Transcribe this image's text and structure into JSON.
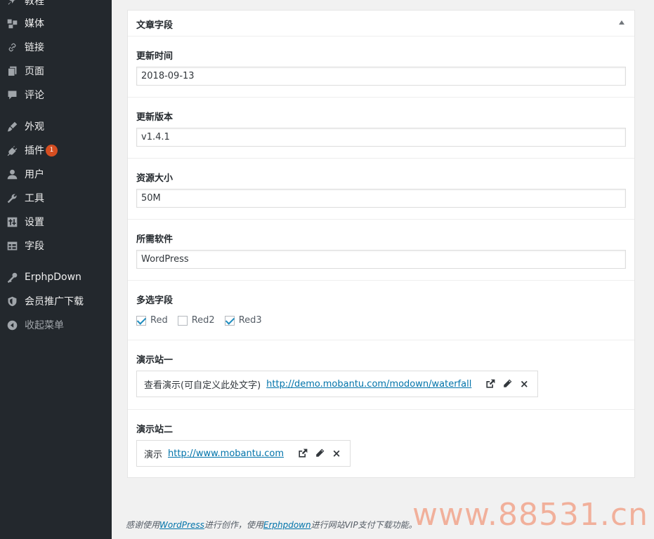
{
  "sidebar": {
    "items": [
      {
        "label": "教程",
        "icon": "thumbtack-icon"
      },
      {
        "label": "媒体",
        "icon": "media-icon"
      },
      {
        "label": "链接",
        "icon": "link-icon"
      },
      {
        "label": "页面",
        "icon": "page-icon"
      },
      {
        "label": "评论",
        "icon": "comment-icon"
      },
      {
        "label": "外观",
        "icon": "brush-icon"
      },
      {
        "label": "插件",
        "icon": "plugin-icon",
        "badge": "1"
      },
      {
        "label": "用户",
        "icon": "user-icon"
      },
      {
        "label": "工具",
        "icon": "wrench-icon"
      },
      {
        "label": "设置",
        "icon": "settings-icon"
      },
      {
        "label": "字段",
        "icon": "table-icon"
      },
      {
        "label": "ErphpDown",
        "icon": "key-icon"
      },
      {
        "label": "会员推广下载",
        "icon": "shield-icon"
      },
      {
        "label": "收起菜单",
        "icon": "collapse-icon"
      }
    ]
  },
  "panel": {
    "title": "文章字段",
    "fields": [
      {
        "label": "更新时间",
        "value": "2018-09-13"
      },
      {
        "label": "更新版本",
        "value": "v1.4.1"
      },
      {
        "label": "资源大小",
        "value": "50M"
      },
      {
        "label": "所需软件",
        "value": "WordPress"
      }
    ],
    "checkbox_field": {
      "label": "多选字段",
      "options": [
        {
          "label": "Red",
          "checked": true
        },
        {
          "label": "Red2",
          "checked": false
        },
        {
          "label": "Red3",
          "checked": true
        }
      ]
    },
    "link_fields": [
      {
        "label": "演示站一",
        "text": "查看演示(可自定义此处文字)",
        "url": "http://demo.mobantu.com/modown/waterfall"
      },
      {
        "label": "演示站二",
        "text": "演示",
        "url": "http://www.mobantu.com"
      }
    ],
    "close_symbol": "×"
  },
  "footer": {
    "prefix": "感谢使用",
    "wp_link": "WordPress",
    "middle": "进行创作，使用",
    "erphp_link": "Erphpdown",
    "suffix": "进行网站VIP支付下载功能。"
  },
  "watermark": "www.88531.cn"
}
